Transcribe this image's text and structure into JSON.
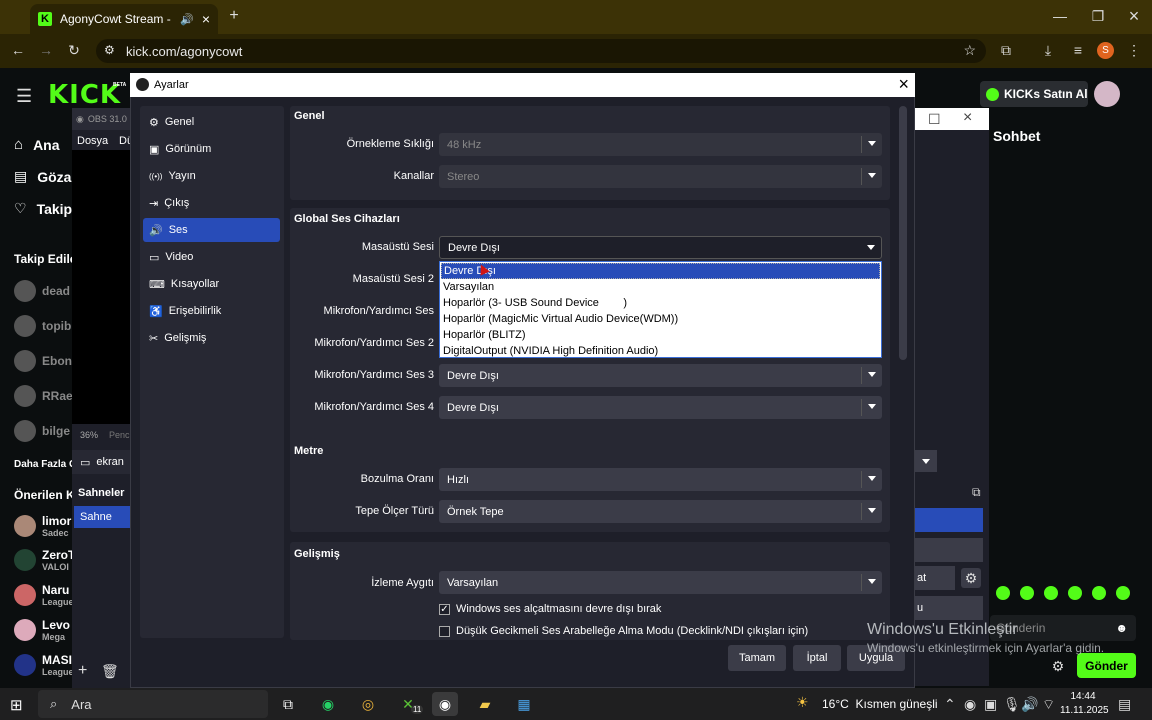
{
  "browser": {
    "tab_title": "AgonyCowt Stream - Watch",
    "url": "kick.com/agonycowt",
    "profile_initial": "S"
  },
  "kick": {
    "logo": "KICK",
    "logo_badge": "BETA",
    "nav": [
      "Ana",
      "Göza",
      "Takip"
    ],
    "followed_header": "Takip Edile",
    "followed": [
      "dead",
      "topib",
      "Ebon",
      "RRae",
      "bilge"
    ],
    "more": "Daha Fazla G",
    "recommended_header": "Önerilen K",
    "recommended": [
      {
        "name": "limor",
        "sub": "Sadec"
      },
      {
        "name": "ZeroT",
        "sub": "VALOI"
      },
      {
        "name": "Naru",
        "sub": "League"
      },
      {
        "name": "Levo",
        "sub": "Mega"
      },
      {
        "name": "MASI",
        "sub": "League"
      }
    ],
    "buy_kicks": "KICKs Satın Al",
    "chat_title": "Sohbet",
    "chat_placeholder": "Gönderin",
    "send": "Gönder"
  },
  "obs": {
    "title": "OBS 31.0",
    "menu": [
      "Dosya",
      "Dü"
    ],
    "zoom": "36%",
    "zoom_suffix": "Penc",
    "screen_label": "ekran",
    "scenes_header": "Sahneler",
    "scene": "Sahne",
    "right_labels": [
      "at",
      "u"
    ]
  },
  "settings": {
    "title": "Ayarlar",
    "nav": [
      {
        "label": "Genel",
        "icon": "gear-icon",
        "glyph": "⚙"
      },
      {
        "label": "Görünüm",
        "icon": "appearance-icon",
        "glyph": "▣"
      },
      {
        "label": "Yayın",
        "icon": "broadcast-icon",
        "glyph": "((•))"
      },
      {
        "label": "Çıkış",
        "icon": "output-icon",
        "glyph": "⇥"
      },
      {
        "label": "Ses",
        "icon": "speaker-icon",
        "glyph": "🔊"
      },
      {
        "label": "Video",
        "icon": "monitor-icon",
        "glyph": "▭"
      },
      {
        "label": "Kısayollar",
        "icon": "keyboard-icon",
        "glyph": "⌨"
      },
      {
        "label": "Erişebilirlik",
        "icon": "accessibility-icon",
        "glyph": "♿"
      },
      {
        "label": "Gelişmiş",
        "icon": "wrench-icon",
        "glyph": "✂"
      }
    ],
    "active_nav": "Ses",
    "general": {
      "header": "Genel",
      "sample_rate_label": "Örnekleme Sıklığı",
      "sample_rate": "48 kHz",
      "channels_label": "Kanallar",
      "channels": "Stereo"
    },
    "global_audio": {
      "header": "Global Ses Cihazları",
      "rows": [
        {
          "label": "Masaüstü Sesi",
          "value": "Devre Dışı"
        },
        {
          "label": "Masaüstü Sesi 2",
          "value": ""
        },
        {
          "label": "Mikrofon/Yardımcı Ses",
          "value": ""
        },
        {
          "label": "Mikrofon/Yardımcı Ses 2",
          "value": ""
        },
        {
          "label": "Mikrofon/Yardımcı Ses 3",
          "value": "Devre Dışı"
        },
        {
          "label": "Mikrofon/Yardımcı Ses 4",
          "value": "Devre Dışı"
        }
      ],
      "dropdown_options": [
        "Devre Dışı",
        "Varsayılan",
        "Hoparlör (3- USB Sound Device        )",
        "Hoparlör (MagicMic Virtual Audio Device(WDM))",
        "Hoparlör (BLITZ)",
        "DigitalOutput (NVIDIA High Definition Audio)"
      ],
      "dropdown_selected": "Devre Dışı"
    },
    "meters": {
      "header": "Metre",
      "decay_label": "Bozulma Oranı",
      "decay": "Hızlı",
      "peak_label": "Tepe Ölçer Türü",
      "peak": "Örnek Tepe"
    },
    "advanced": {
      "header": "Gelişmiş",
      "monitor_label": "İzleme Aygıtı",
      "monitor": "Varsayılan",
      "ducking": "Windows ses alçaltmasını devre dışı bırak",
      "ducking_checked": true,
      "low_latency": "Düşük Gecikmeli Ses Arabelleğe Alma Modu (Decklink/NDI çıkışları için)",
      "low_latency_checked": false
    },
    "buttons": {
      "ok": "Tamam",
      "cancel": "İptal",
      "apply": "Uygula"
    }
  },
  "windows": {
    "activation_title": "Windows'u Etkinleştir",
    "activation_sub": "Windows'u etkinleştirmek için Ayarlar'a gidin."
  },
  "taskbar": {
    "search": "Ara",
    "weather": "16°C  Kısmen güneşli",
    "time": "14:44",
    "date": "11.11.2025",
    "badge": "11"
  }
}
